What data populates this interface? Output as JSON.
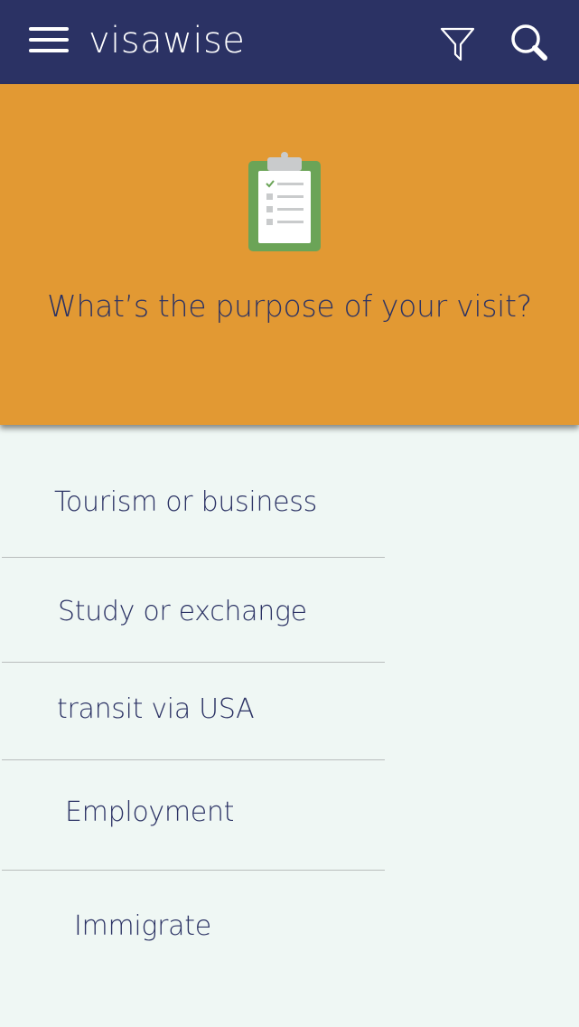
{
  "app": {
    "title": "visawise"
  },
  "header": {
    "menu_icon": "hamburger-menu-icon",
    "filter_icon": "filter-funnel-icon",
    "search_icon": "search-magnifier-icon"
  },
  "hero": {
    "icon": "clipboard-checklist-icon",
    "question": "What’s the purpose of your visit?"
  },
  "options": [
    {
      "label": "Tourism or business"
    },
    {
      "label": "Study or exchange"
    },
    {
      "label": "transit via USA"
    },
    {
      "label": "Employment"
    },
    {
      "label": "Immigrate"
    }
  ],
  "colors": {
    "header_bg": "#2b3264",
    "hero_bg": "#e29933",
    "page_bg": "#eff7f4",
    "text": "#2b3264",
    "clipboard_green": "#6ba457"
  }
}
